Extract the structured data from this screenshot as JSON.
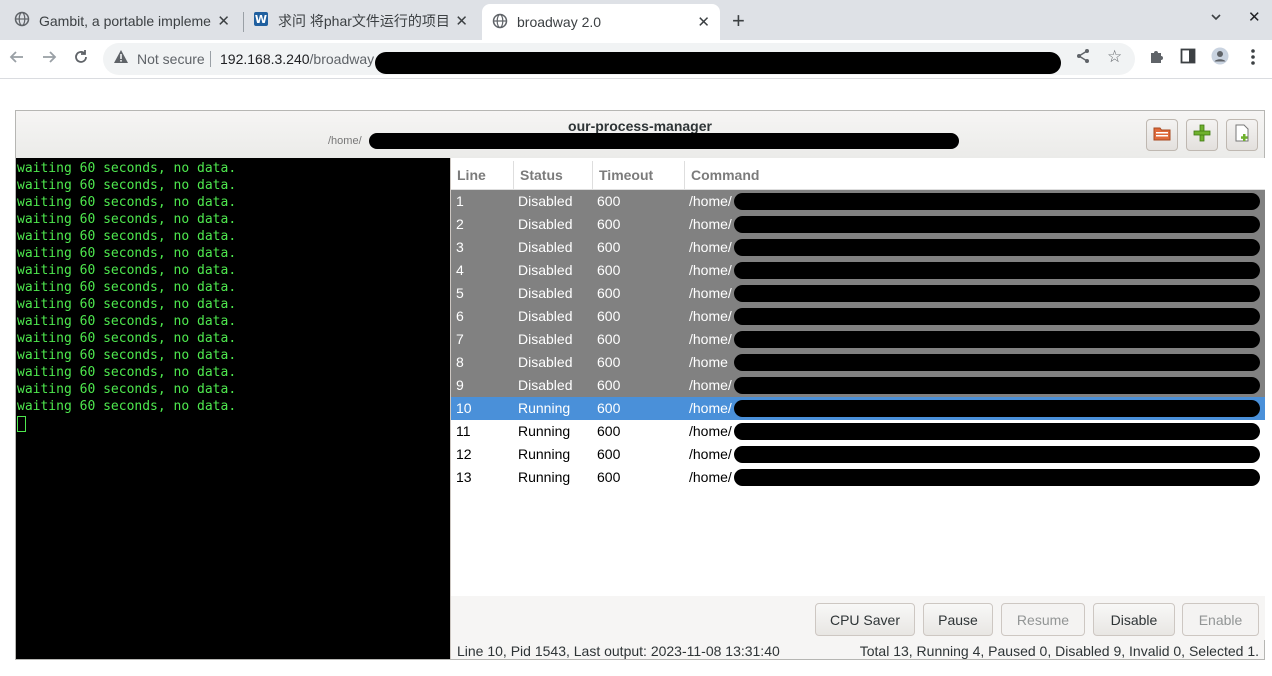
{
  "browser": {
    "tabs": [
      {
        "label": "Gambit, a portable impleme",
        "icon": "globe-icon"
      },
      {
        "label": "求问 将phar文件运行的项目",
        "icon": "site-logo-icon"
      },
      {
        "label": "broadway 2.0",
        "icon": "globe-icon"
      }
    ],
    "security_label": "Not secure",
    "url_host": "192.168.3.240",
    "url_path": "/broadway"
  },
  "app": {
    "title": "our-process-manager",
    "subtitle_prefix": "/home/",
    "header_buttons": [
      "open-folder-icon",
      "add-icon",
      "new-file-icon"
    ]
  },
  "terminal": {
    "lines": [
      "waiting 60 seconds, no data.",
      "waiting 60 seconds, no data.",
      "waiting 60 seconds, no data.",
      "waiting 60 seconds, no data.",
      "waiting 60 seconds, no data.",
      "waiting 60 seconds, no data.",
      "waiting 60 seconds, no data.",
      "waiting 60 seconds, no data.",
      "waiting 60 seconds, no data.",
      "waiting 60 seconds, no data.",
      "waiting 60 seconds, no data.",
      "waiting 60 seconds, no data.",
      "waiting 60 seconds, no data.",
      "waiting 60 seconds, no data.",
      "waiting 60 seconds, no data."
    ]
  },
  "table": {
    "headers": {
      "line": "Line",
      "status": "Status",
      "timeout": "Timeout",
      "command": "Command"
    },
    "rows": [
      {
        "line": "1",
        "status": "Disabled",
        "timeout": "600",
        "command": "/home/"
      },
      {
        "line": "2",
        "status": "Disabled",
        "timeout": "600",
        "command": "/home/"
      },
      {
        "line": "3",
        "status": "Disabled",
        "timeout": "600",
        "command": "/home/"
      },
      {
        "line": "4",
        "status": "Disabled",
        "timeout": "600",
        "command": "/home/"
      },
      {
        "line": "5",
        "status": "Disabled",
        "timeout": "600",
        "command": "/home/"
      },
      {
        "line": "6",
        "status": "Disabled",
        "timeout": "600",
        "command": "/home/"
      },
      {
        "line": "7",
        "status": "Disabled",
        "timeout": "600",
        "command": "/home/"
      },
      {
        "line": "8",
        "status": "Disabled",
        "timeout": "600",
        "command": "/home"
      },
      {
        "line": "9",
        "status": "Disabled",
        "timeout": "600",
        "command": "/home/"
      },
      {
        "line": "10",
        "status": "Running",
        "timeout": "600",
        "command": "/home/"
      },
      {
        "line": "11",
        "status": "Running",
        "timeout": "600",
        "command": "/home/"
      },
      {
        "line": "12",
        "status": "Running",
        "timeout": "600",
        "command": "/home/"
      },
      {
        "line": "13",
        "status": "Running",
        "timeout": "600",
        "command": "/home/"
      }
    ],
    "selected_line": "10"
  },
  "actions": {
    "cpu_saver": "CPU Saver",
    "pause": "Pause",
    "resume": "Resume",
    "disable": "Disable",
    "enable": "Enable"
  },
  "status": {
    "left": "Line 10, Pid 1543,  Last output: 2023-11-08 13:31:40",
    "right": "Total 13, Running 4, Paused 0, Disabled 9, Invalid 0, Selected 1."
  },
  "colors": {
    "terminal_text": "#4ee84e",
    "disabled_row": "#818181",
    "selected_row": "#4a90d9"
  }
}
